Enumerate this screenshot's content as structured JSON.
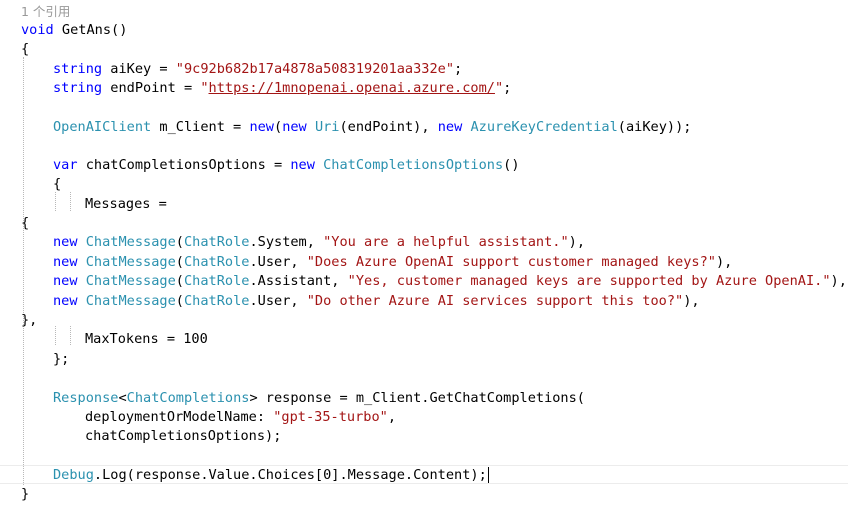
{
  "codelens": "1 个引用",
  "lines": {
    "l2": {
      "t1": "void",
      "t2": " GetAns()"
    },
    "l3": {
      "t1": "{"
    },
    "l4": {
      "t1": "string",
      "t2": " aiKey = ",
      "t3": "\"9c92b682b17a4878a508319201aa332e\"",
      "t4": ";"
    },
    "l5": {
      "t1": "string",
      "t2": " endPoint = ",
      "t3": "\"",
      "t4": "https://1mnopenai.openai.azure.com/",
      "t5": "\"",
      "t6": ";"
    },
    "l7": {
      "t1": "OpenAIClient",
      "t2": " m_Client = ",
      "t3": "new",
      "t4": "(",
      "t5": "new",
      "t6": " ",
      "t7": "Uri",
      "t8": "(endPoint), ",
      "t9": "new",
      "t10": " ",
      "t11": "AzureKeyCredential",
      "t12": "(aiKey));"
    },
    "l9": {
      "t1": "var",
      "t2": " chatCompletionsOptions = ",
      "t3": "new",
      "t4": " ",
      "t5": "ChatCompletionsOptions",
      "t6": "()"
    },
    "l10": {
      "t1": "{"
    },
    "l11": {
      "t1": "Messages ="
    },
    "l12": {
      "t1": "{"
    },
    "l13": {
      "t1": "new",
      "t2": " ",
      "t3": "ChatMessage",
      "t4": "(",
      "t5": "ChatRole",
      "t6": ".System, ",
      "t7": "\"You are a helpful assistant.\"",
      "t8": "),"
    },
    "l14": {
      "t1": "new",
      "t2": " ",
      "t3": "ChatMessage",
      "t4": "(",
      "t5": "ChatRole",
      "t6": ".User, ",
      "t7": "\"Does Azure OpenAI support customer managed keys?\"",
      "t8": "),"
    },
    "l15": {
      "t1": "new",
      "t2": " ",
      "t3": "ChatMessage",
      "t4": "(",
      "t5": "ChatRole",
      "t6": ".Assistant, ",
      "t7": "\"Yes, customer managed keys are supported by Azure OpenAI.\"",
      "t8": "),"
    },
    "l16": {
      "t1": "new",
      "t2": " ",
      "t3": "ChatMessage",
      "t4": "(",
      "t5": "ChatRole",
      "t6": ".User, ",
      "t7": "\"Do other Azure AI services support this too?\"",
      "t8": "),"
    },
    "l17": {
      "t1": "},"
    },
    "l18": {
      "t1": "MaxTokens = 100"
    },
    "l19": {
      "t1": "};"
    },
    "l21": {
      "t1": "Response",
      "t2": "<",
      "t3": "ChatCompletions",
      "t4": "> response = m_Client.GetChatCompletions("
    },
    "l22": {
      "t1": "deploymentOrModelName: ",
      "t2": "\"gpt-35-turbo\"",
      "t3": ","
    },
    "l23": {
      "t1": "chatCompletionsOptions);"
    },
    "l25": {
      "t1": "Debug",
      "t2": ".Log(response.Value.Choices[0].Message.Content);"
    },
    "l26": {
      "t1": "}"
    }
  },
  "colors": {
    "keyword": "#0000ff",
    "type": "#2b91af",
    "string": "#a31515",
    "text": "#000000",
    "codelens": "#999999"
  }
}
